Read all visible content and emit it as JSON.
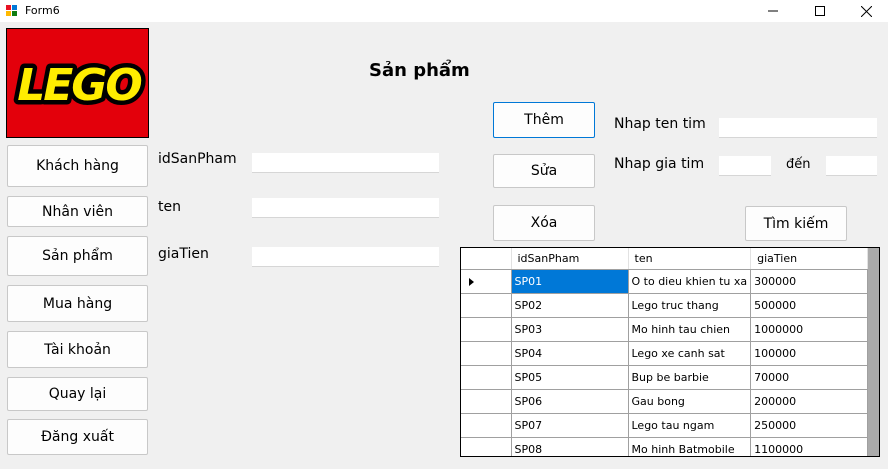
{
  "window": {
    "title": "Form6",
    "minimize_icon": "minimize-icon",
    "maximize_icon": "maximize-icon",
    "close_icon": "close-icon"
  },
  "logo": {
    "text": "LEGO",
    "bg_color": "#e3000b",
    "text_color": "#ffed00"
  },
  "nav": {
    "customers": "Khách hàng",
    "employees": "Nhân viên",
    "products": "Sản phẩm",
    "purchase": "Mua hàng",
    "account": "Tài khoản",
    "back": "Quay lại",
    "logout": "Đăng xuất"
  },
  "page_title": "Sản phẩm",
  "form": {
    "id_label": "idSanPham",
    "id_value": "",
    "name_label": "ten",
    "name_value": "",
    "price_label": "giaTien",
    "price_value": ""
  },
  "actions": {
    "add": "Thêm",
    "edit": "Sửa",
    "delete": "Xóa",
    "search": "Tìm kiếm"
  },
  "search": {
    "name_label": "Nhap ten tim",
    "name_value": "",
    "price_label": "Nhap gia tim",
    "price_from": "",
    "to_label": "đến",
    "price_to": ""
  },
  "grid": {
    "columns": [
      "idSanPham",
      "ten",
      "giaTien"
    ],
    "rows": [
      [
        "SP01",
        "O to dieu khien tu xa",
        "300000"
      ],
      [
        "SP02",
        "Lego truc thang",
        "500000"
      ],
      [
        "SP03",
        "Mo hinh tau chien",
        "1000000"
      ],
      [
        "SP04",
        "Lego xe canh sat",
        "100000"
      ],
      [
        "SP05",
        "Bup be barbie",
        "70000"
      ],
      [
        "SP06",
        "Gau bong",
        "200000"
      ],
      [
        "SP07",
        "Lego tau ngam",
        "250000"
      ],
      [
        "SP08",
        "Mo hinh Batmobile",
        "1100000"
      ]
    ],
    "selected_row": 0,
    "selection_color": "#0078d7"
  }
}
